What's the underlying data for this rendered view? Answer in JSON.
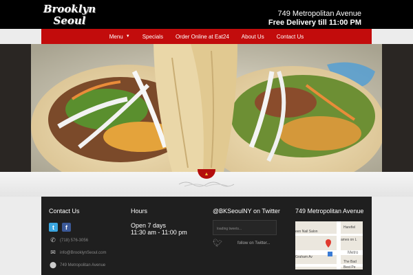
{
  "brand": {
    "line1": "Brooklyn",
    "line2": "Seoul"
  },
  "header": {
    "address": "749 Metropolitan Avenue",
    "delivery": "Free Delivery till 11:00 PM"
  },
  "nav": {
    "items": [
      {
        "label": "Menu",
        "has_dropdown": true
      },
      {
        "label": "Specials"
      },
      {
        "label": "Order Online at Eat24"
      },
      {
        "label": "About Us"
      },
      {
        "label": "Contact Us"
      }
    ]
  },
  "hero": {
    "image": "tacos-photo"
  },
  "footer": {
    "contact": {
      "title": "Contact Us",
      "phone": "(718) 576-3056",
      "email": "info@BrooklynSeoul.com",
      "address": "749 Metropolitan Avenue"
    },
    "hours": {
      "title": "Hours",
      "line1": "Open 7 days",
      "line2": "11:30 am - 11:00 pm"
    },
    "twitter": {
      "title": "@BKSeoulNY on Twitter",
      "loading": "loading tweets...",
      "follow": "follow on Twitter..."
    },
    "map": {
      "title": "749 Metropolitan Avenue",
      "labels": {
        "nail_salon": "een Nail Salon",
        "harefield": "Harefiel",
        "james": "ames on L",
        "graham": "Graham Av",
        "metro": "Metro",
        "the_bad": "The Bad",
        "best": "Best Pe"
      }
    }
  },
  "colors": {
    "nav_red": "#c20c0c",
    "header_black": "#000000",
    "footer_dark": "#1f1f1f"
  }
}
